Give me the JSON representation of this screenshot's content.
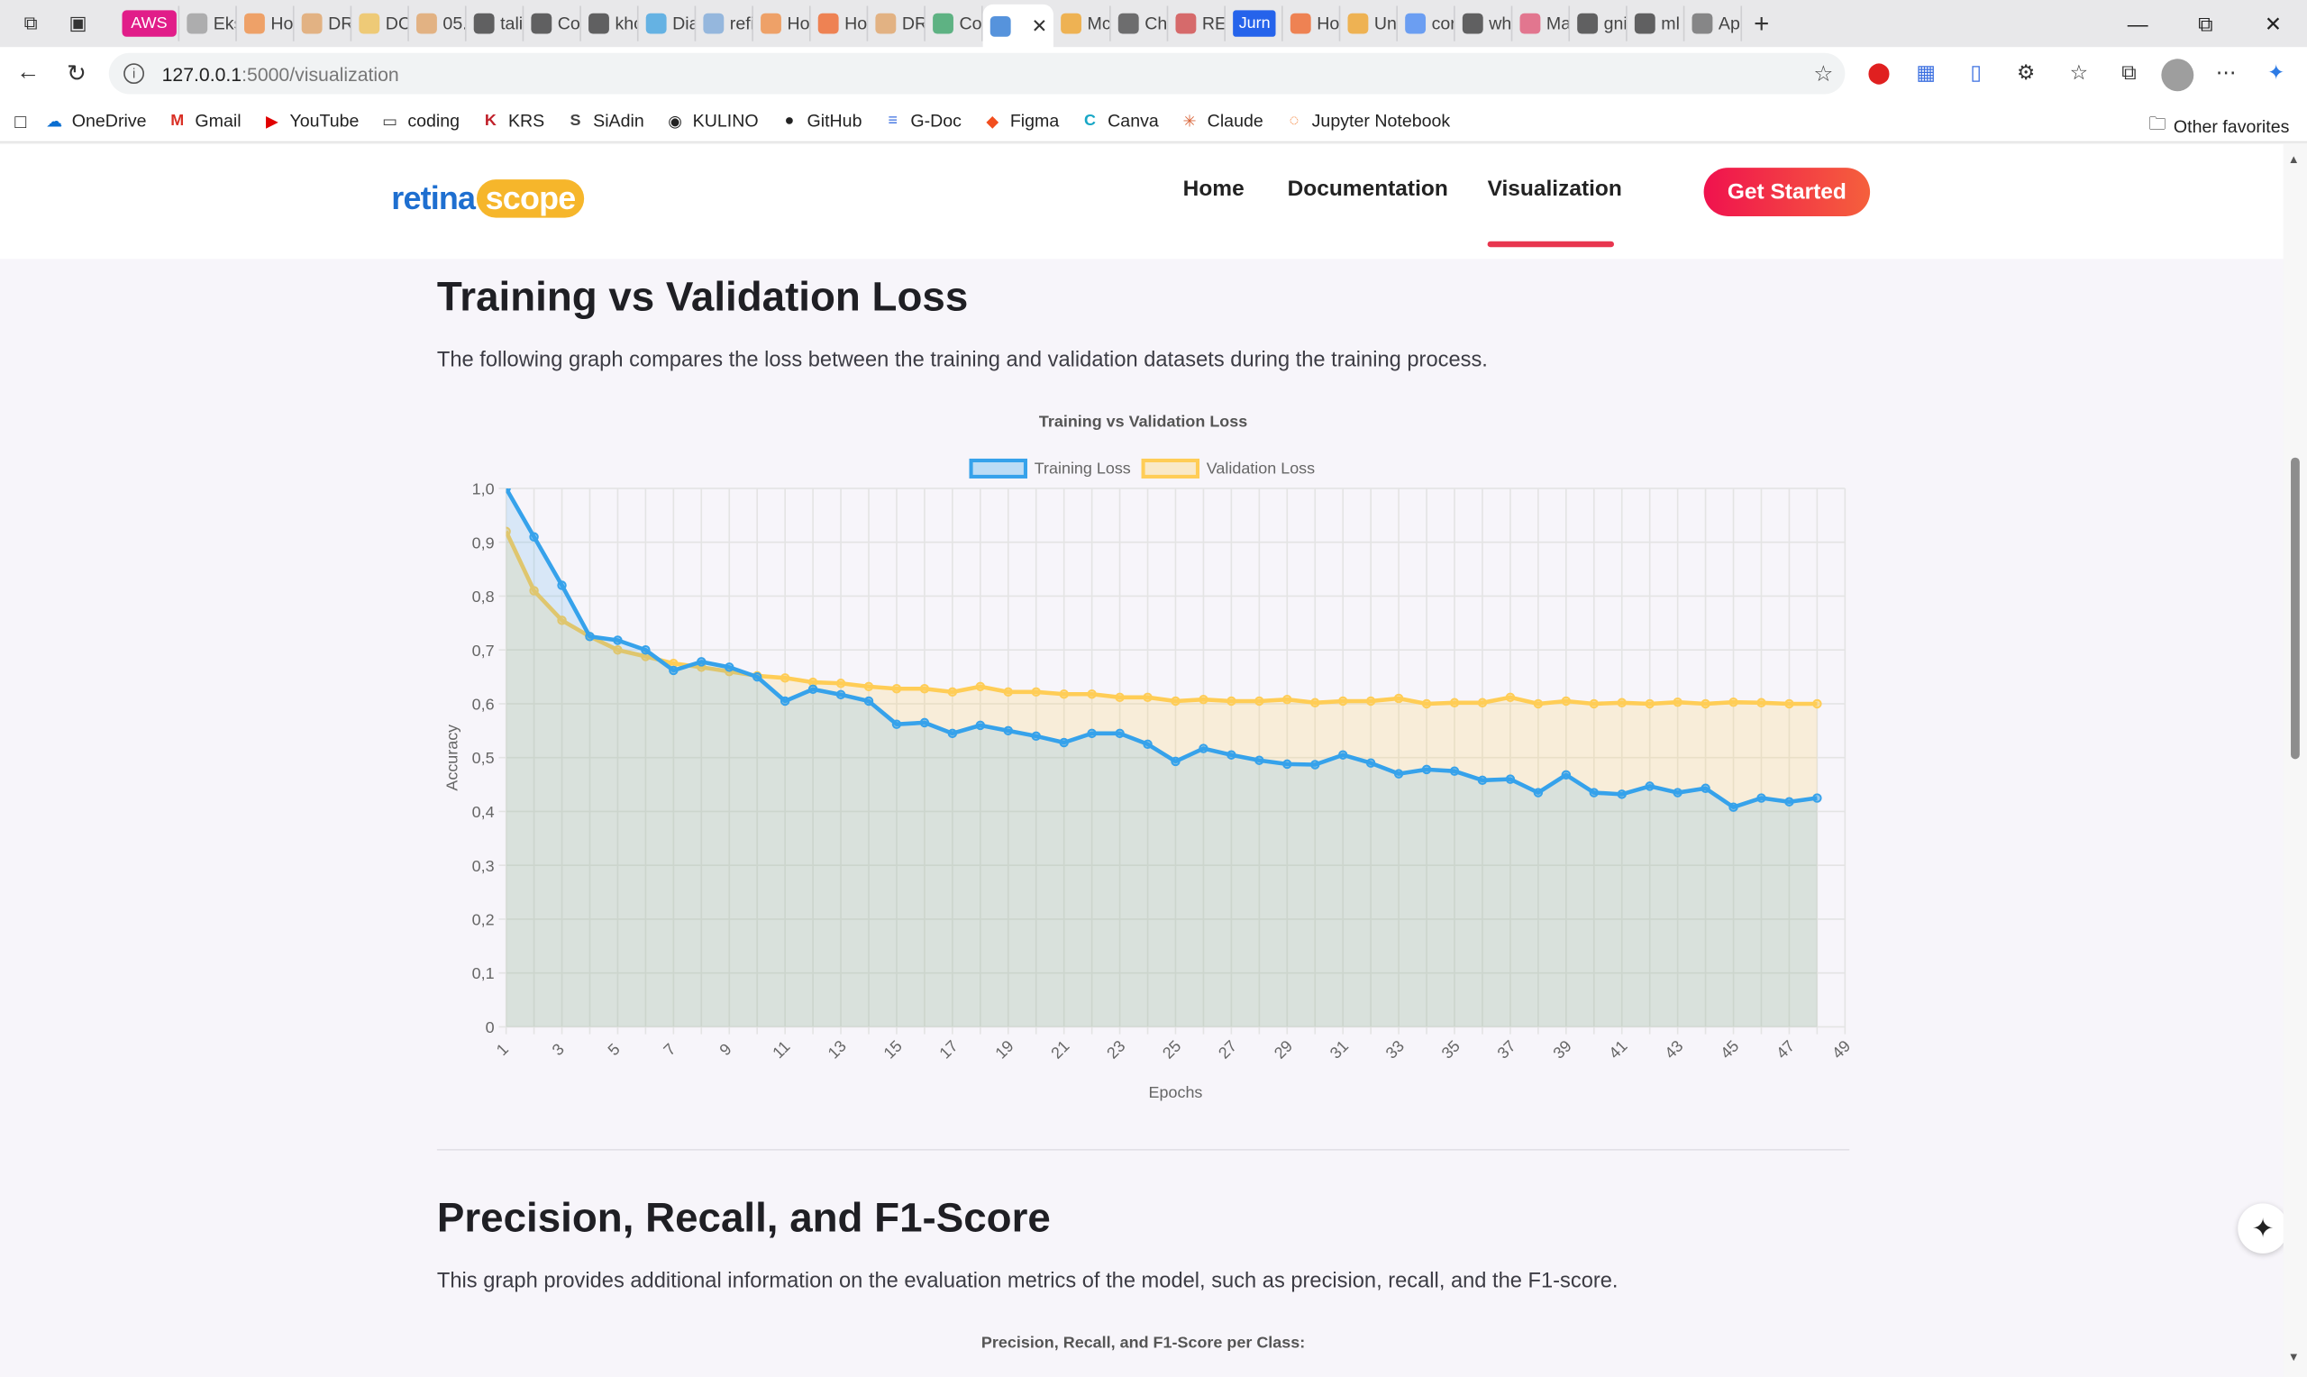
{
  "browser": {
    "tabs": [
      {
        "label": "AWS",
        "fav": "#e11d89"
      },
      {
        "label": "Eks",
        "fav": "#999999"
      },
      {
        "label": "Ho",
        "fav": "#f08a3c"
      },
      {
        "label": "DR",
        "fav": "#e0a060"
      },
      {
        "label": "DC",
        "fav": "#f0c050"
      },
      {
        "label": "05.",
        "fav": "#e0a060"
      },
      {
        "label": "tali",
        "fav": "#333333"
      },
      {
        "label": "Co",
        "fav": "#333333"
      },
      {
        "label": "khc",
        "fav": "#333333"
      },
      {
        "label": "Dia",
        "fav": "#3aa0e0"
      },
      {
        "label": "refi",
        "fav": "#7aa7d8"
      },
      {
        "label": "Ho",
        "fav": "#f08a3c"
      },
      {
        "label": "Ho",
        "fav": "#f06020"
      },
      {
        "label": "DR",
        "fav": "#e0a060"
      },
      {
        "label": "Co",
        "fav": "#30a060"
      },
      {
        "label": "",
        "fav": "#1e6fd0",
        "active": true
      },
      {
        "label": "Mc",
        "fav": "#f0a020"
      },
      {
        "label": "Ch",
        "fav": "#444444"
      },
      {
        "label": "REI",
        "fav": "#d04040"
      },
      {
        "label": "Jurn",
        "fav": "#2563eb"
      },
      {
        "label": "Ho",
        "fav": "#f06020"
      },
      {
        "label": "Un",
        "fav": "#f0a020"
      },
      {
        "label": "cor",
        "fav": "#4285f4"
      },
      {
        "label": "wh",
        "fav": "#333333"
      },
      {
        "label": "Ma",
        "fav": "#e05070"
      },
      {
        "label": "gni",
        "fav": "#333333"
      },
      {
        "label": "ml",
        "fav": "#333333"
      },
      {
        "label": "Ap",
        "fav": "#666666"
      }
    ],
    "address": {
      "host": "127.0.0.1",
      "path": ":5000/visualization"
    },
    "bookmarks": [
      {
        "label": "OneDrive",
        "icon": "cloud-icon",
        "color": "#0a6ed1"
      },
      {
        "label": "Gmail",
        "icon": "gmail-icon",
        "color": "#d93025"
      },
      {
        "label": "YouTube",
        "icon": "youtube-icon",
        "color": "#e00000"
      },
      {
        "label": "coding",
        "icon": "folder-icon",
        "color": "#444444"
      },
      {
        "label": "KRS",
        "icon": "krs-icon",
        "color": "#c0202a"
      },
      {
        "label": "SiAdin",
        "icon": "siadin-icon",
        "color": "#444444"
      },
      {
        "label": "KULINO",
        "icon": "kulino-icon",
        "color": "#222222"
      },
      {
        "label": "GitHub",
        "icon": "github-icon",
        "color": "#222222"
      },
      {
        "label": "G-Doc",
        "icon": "gdoc-icon",
        "color": "#3b6fe0"
      },
      {
        "label": "Figma",
        "icon": "figma-icon",
        "color": "#f24e1e"
      },
      {
        "label": "Canva",
        "icon": "canva-icon",
        "color": "#18a7c6"
      },
      {
        "label": "Claude",
        "icon": "claude-icon",
        "color": "#d9663b"
      },
      {
        "label": "Jupyter Notebook",
        "icon": "jupyter-icon",
        "color": "#f37726"
      }
    ],
    "other_favorites": "Other favorites"
  },
  "site": {
    "logo_main": "retina",
    "logo_accent": "scope",
    "nav": [
      "Home",
      "Documentation",
      "Visualization"
    ],
    "cta": "Get Started"
  },
  "section1": {
    "title": "Training vs Validation Loss",
    "description": "The following graph compares the loss between the training and validation datasets during the training process."
  },
  "section2": {
    "title": "Precision, Recall, and F1-Score",
    "description": "This graph provides additional information on the evaluation metrics of the model, such as precision, recall, and the F1-score.",
    "chart_title": "Precision, Recall, and F1-Score per Class:"
  },
  "chart_data": {
    "type": "line",
    "title": "Training vs Validation Loss",
    "xlabel": "Epochs",
    "ylabel": "Accuracy",
    "ylim": [
      0,
      1.0
    ],
    "yticks": [
      "0",
      "0,1",
      "0,2",
      "0,3",
      "0,4",
      "0,5",
      "0,6",
      "0,7",
      "0,8",
      "0,9",
      "1,0"
    ],
    "xticks": [
      "1",
      "3",
      "5",
      "7",
      "9",
      "11",
      "13",
      "15",
      "17",
      "19",
      "21",
      "23",
      "25",
      "27",
      "29",
      "31",
      "33",
      "35",
      "37",
      "39",
      "41",
      "43",
      "45",
      "47",
      "49"
    ],
    "x": [
      1,
      2,
      3,
      4,
      5,
      6,
      7,
      8,
      9,
      10,
      11,
      12,
      13,
      14,
      15,
      16,
      17,
      18,
      19,
      20,
      21,
      22,
      23,
      24,
      25,
      26,
      27,
      28,
      29,
      30,
      31,
      32,
      33,
      34,
      35,
      36,
      37,
      38,
      39,
      40,
      41,
      42,
      43,
      44,
      45,
      46,
      47,
      48
    ],
    "legend_position": "top",
    "grid": true,
    "series": [
      {
        "name": "Training Loss",
        "color": "#36a2eb",
        "values": [
          1.12,
          0.91,
          0.82,
          0.725,
          0.718,
          0.7,
          0.662,
          0.678,
          0.668,
          0.65,
          0.605,
          0.627,
          0.617,
          0.605,
          0.562,
          0.565,
          0.545,
          0.56,
          0.55,
          0.54,
          0.528,
          0.545,
          0.545,
          0.525,
          0.493,
          0.517,
          0.505,
          0.495,
          0.488,
          0.487,
          0.505,
          0.49,
          0.47,
          0.478,
          0.475,
          0.458,
          0.46,
          0.435,
          0.468,
          0.435,
          0.432,
          0.447,
          0.435,
          0.443,
          0.408,
          0.425,
          0.418,
          0.425
        ]
      },
      {
        "name": "Validation Loss",
        "color": "#ffcd56",
        "values": [
          0.92,
          0.81,
          0.755,
          0.725,
          0.7,
          0.688,
          0.675,
          0.668,
          0.66,
          0.652,
          0.648,
          0.64,
          0.638,
          0.632,
          0.628,
          0.628,
          0.622,
          0.632,
          0.622,
          0.622,
          0.618,
          0.618,
          0.612,
          0.612,
          0.605,
          0.608,
          0.605,
          0.605,
          0.608,
          0.602,
          0.605,
          0.605,
          0.61,
          0.6,
          0.602,
          0.602,
          0.612,
          0.6,
          0.605,
          0.6,
          0.602,
          0.6,
          0.603,
          0.6,
          0.603,
          0.602,
          0.6,
          0.6
        ]
      }
    ]
  }
}
